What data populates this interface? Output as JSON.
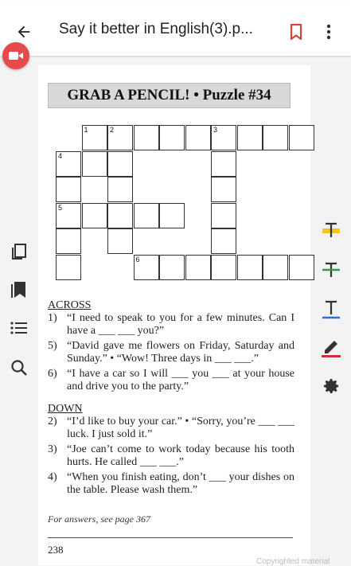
{
  "app": {
    "title": "Say it better in English(3).p...",
    "colors": {
      "recording": "#e8494a",
      "bookmark": "#d9443a",
      "highlight": "#f5c518",
      "strike": "#2e9e48",
      "underline": "#2a6fd6",
      "draw": "#d32f2f"
    },
    "icons": {
      "back": "arrow-left-icon",
      "bookmark": "bookmark-icon",
      "more": "more-vertical-icon",
      "record": "video-camera-icon",
      "left": [
        "page-view-icon",
        "bookmarks-icon",
        "outline-list-icon",
        "search-icon"
      ],
      "right": [
        "highlight-text-icon",
        "strikethrough-text-icon",
        "underline-text-icon",
        "draw-pen-icon",
        "settings-gear-icon"
      ]
    }
  },
  "document": {
    "puzzle_title": "GRAB A PENCIL! • Puzzle #34",
    "grid_numbers": [
      "1",
      "2",
      "3",
      "4",
      "5",
      "6"
    ],
    "across_heading": "ACROSS",
    "across": [
      {
        "num": "1)",
        "text": "“I need to speak to you for a few minutes. Can I have a ___ ___ you?”"
      },
      {
        "num": "5)",
        "text": "“David gave me flowers on Friday, Saturday and Sunday.” • “Wow! Three days in ___ ___.”"
      },
      {
        "num": "6)",
        "text": "“I have a car so I will ___ you ___ at your house and drive you to the party.”"
      }
    ],
    "down_heading": "DOWN",
    "down": [
      {
        "num": "2)",
        "text": "“I’d like to buy your car.” • “Sorry, you’re ___ ___ luck. I just sold it.”"
      },
      {
        "num": "3)",
        "text": "“Joe can’t come to work today because his tooth hurts. He called ___ ___.”"
      },
      {
        "num": "4)",
        "text": "“When you finish eating, don’t ___ your dishes on the table. Please wash them.”"
      }
    ],
    "answers_note": "For answers, see page 367",
    "page_number": "238",
    "watermark": "Copyrighted material"
  }
}
